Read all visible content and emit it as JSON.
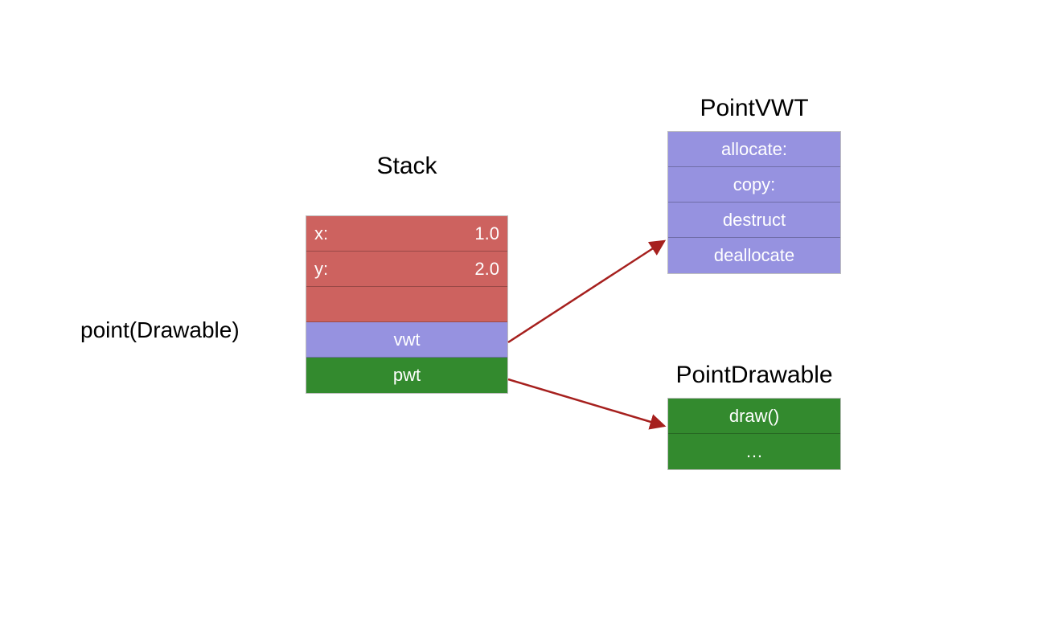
{
  "labels": {
    "side": "point(Drawable)",
    "stack_title": "Stack",
    "vwt_title": "PointVWT",
    "pwt_title": "PointDrawable"
  },
  "stack": {
    "rows": [
      {
        "key": "x:",
        "val": "1.0"
      },
      {
        "key": "y:",
        "val": "2.0"
      }
    ],
    "empty_row": "",
    "vwt_label": "vwt",
    "pwt_label": "pwt"
  },
  "vwt": {
    "rows": [
      "allocate:",
      "copy:",
      "destruct",
      "deallocate"
    ]
  },
  "pwt": {
    "rows": [
      "draw()",
      "…"
    ]
  },
  "colors": {
    "red": "#cd625f",
    "purple": "#9692e0",
    "green": "#338a2e",
    "arrow": "#a6201e"
  }
}
